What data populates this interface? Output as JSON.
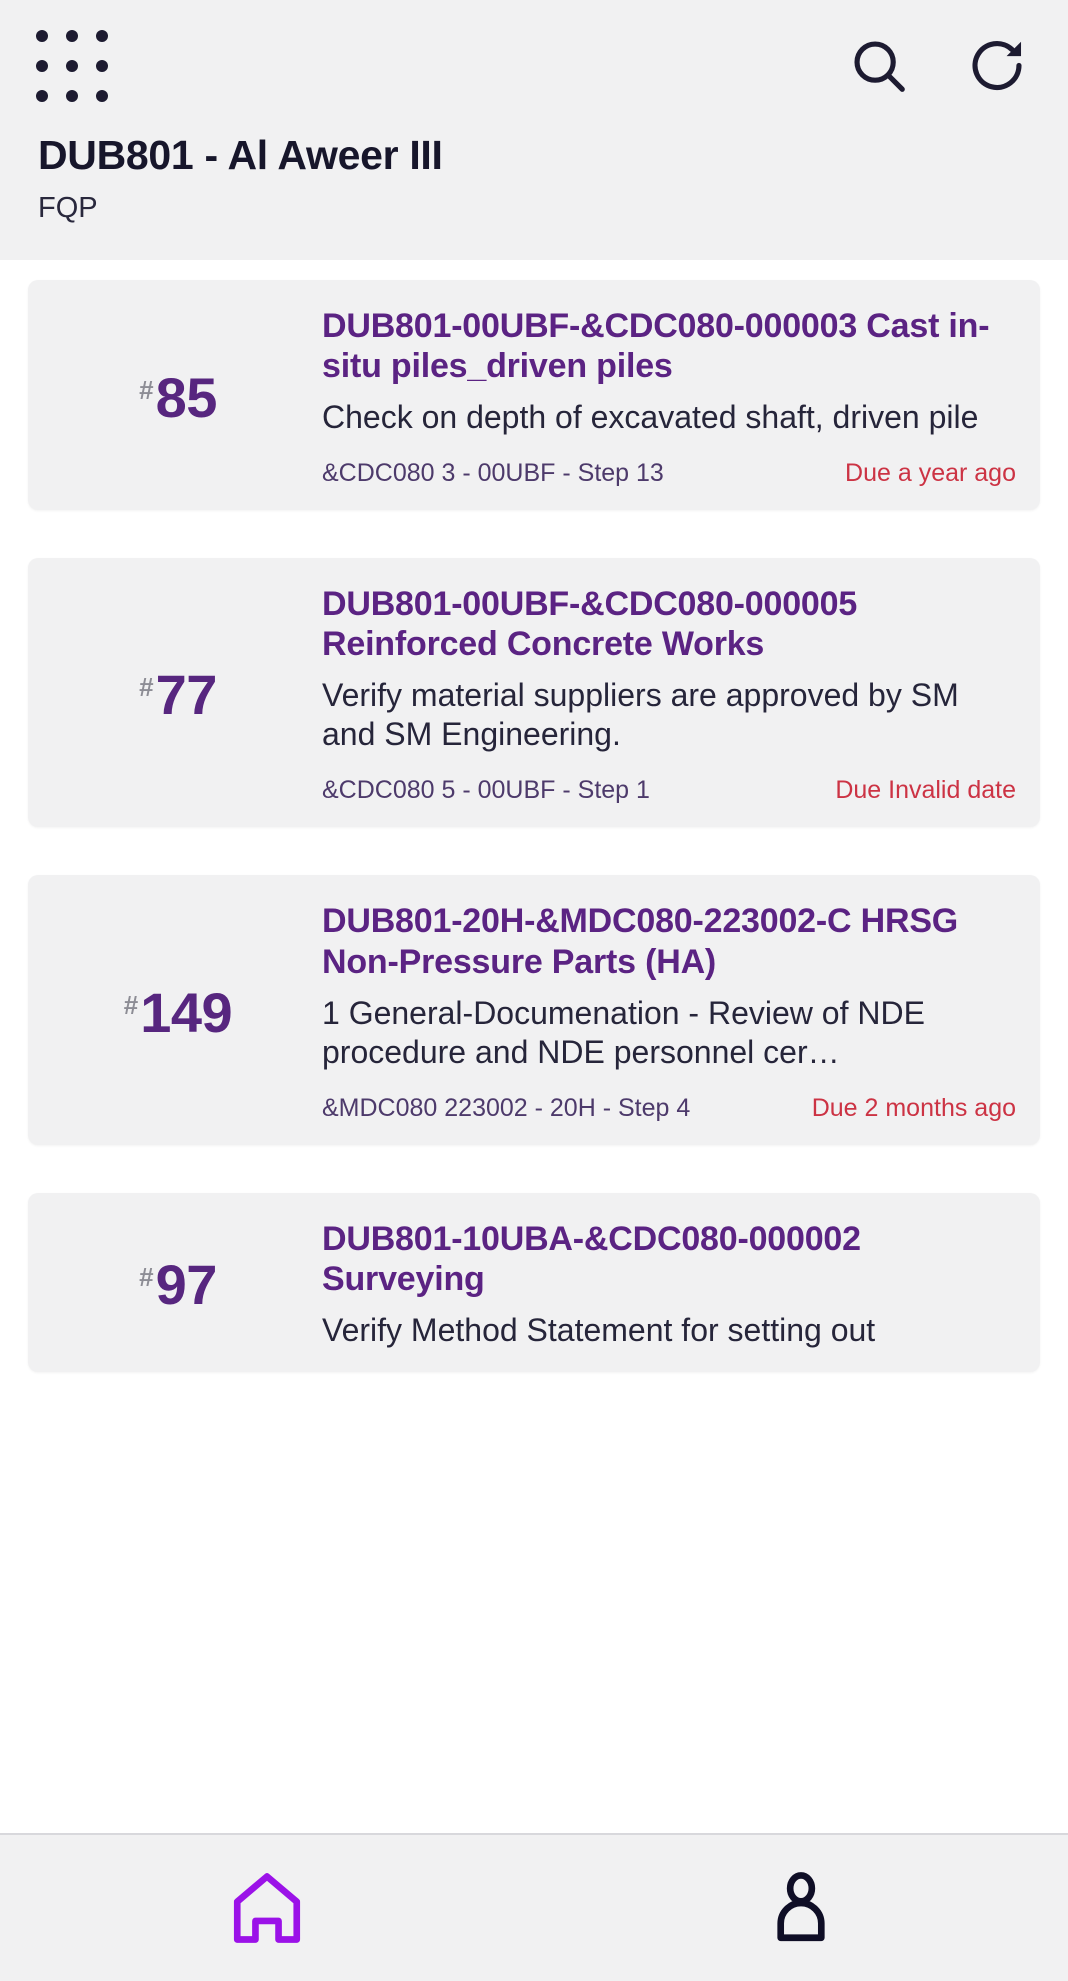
{
  "header": {
    "apps_icon": "apps-grid-icon",
    "search_icon": "search-icon",
    "refresh_icon": "refresh-icon",
    "title": "DUB801 - Al Aweer III",
    "subtitle": "FQP"
  },
  "colors": {
    "accent_purple": "#5b2383",
    "index_purple": "#57267f",
    "due_red": "#cc3344",
    "meta_purple": "#4d3a6b",
    "card_bg": "#f1f1f2",
    "header_bg": "#f1f1f2",
    "nav_active": "#9b12e8",
    "nav_inactive": "#0f0e26",
    "text_dark": "#17162b"
  },
  "cards": [
    {
      "hash": "#",
      "index": "85",
      "title": "DUB801-00UBF-&CDC080-000003 Cast in-situ piles_driven piles",
      "description": "Check on depth of excavated shaft, driven pile",
      "meta": "&CDC080 3 - 00UBF - Step 13",
      "due": "Due a year ago"
    },
    {
      "hash": "#",
      "index": "77",
      "title": "DUB801-00UBF-&CDC080-000005 Reinforced Concrete Works",
      "description": "Verify material suppliers are approved by SM and SM Engineering.",
      "meta": "&CDC080 5 - 00UBF - Step 1",
      "due": "Due Invalid date"
    },
    {
      "hash": "#",
      "index": "149",
      "title": "DUB801-20H-&MDC080-223002-C HRSG Non-Pressure Parts (HA)",
      "description": "1 General-Documenation - Review of NDE procedure and NDE personnel cer…",
      "meta": "&MDC080 223002 - 20H - Step 4",
      "due": "Due 2 months ago"
    },
    {
      "hash": "#",
      "index": "97",
      "title": "DUB801-10UBA-&CDC080-000002 Surveying",
      "description": "Verify Method Statement for setting out",
      "meta": "",
      "due": ""
    }
  ],
  "bottom_nav": [
    {
      "name": "home",
      "icon": "home-icon",
      "active": true
    },
    {
      "name": "profile",
      "icon": "person-icon",
      "active": false
    }
  ]
}
